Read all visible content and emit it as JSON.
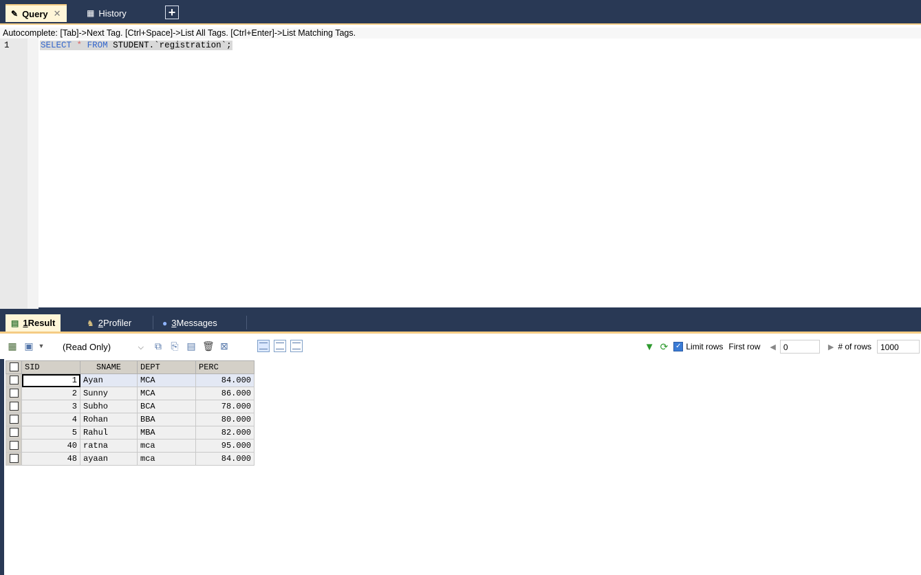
{
  "top_tabs": [
    {
      "label": "Query",
      "icon": "query-icon",
      "active": true
    },
    {
      "label": "History",
      "icon": "history-icon",
      "active": false
    }
  ],
  "editor": {
    "autocomplete_hint": "Autocomplete: [Tab]->Next Tag. [Ctrl+Space]->List All Tags. [Ctrl+Enter]->List Matching Tags.",
    "line_number": "1",
    "code": {
      "kw_select": "SELECT",
      "star": "*",
      "kw_from": "FROM",
      "rest": "STUDENT.`registration`;"
    }
  },
  "result_tabs": [
    {
      "num": "1",
      "label": " Result",
      "active": true
    },
    {
      "num": "2",
      "label": " Profiler",
      "active": false
    },
    {
      "num": "3",
      "label": " Messages",
      "active": false
    }
  ],
  "toolbar": {
    "mode_value": "(Read Only)",
    "limit_rows_label": "Limit rows",
    "first_row_label": "First row",
    "first_row_value": "0",
    "num_rows_label": "# of rows",
    "num_rows_value": "1000"
  },
  "grid": {
    "columns": [
      "SID",
      "SNAME",
      "DEPT",
      "PERC"
    ],
    "rows": [
      [
        "1",
        "Ayan",
        "MCA",
        "84.000"
      ],
      [
        "2",
        "Sunny",
        "MCA",
        "86.000"
      ],
      [
        "3",
        "Subho",
        "BCA",
        "78.000"
      ],
      [
        "4",
        "Rohan",
        "BBA",
        "80.000"
      ],
      [
        "5",
        "Rahul",
        "MBA",
        "82.000"
      ],
      [
        "40",
        "ratna",
        "mca",
        "95.000"
      ],
      [
        "48",
        "ayaan",
        "mca",
        "84.000"
      ]
    ]
  }
}
